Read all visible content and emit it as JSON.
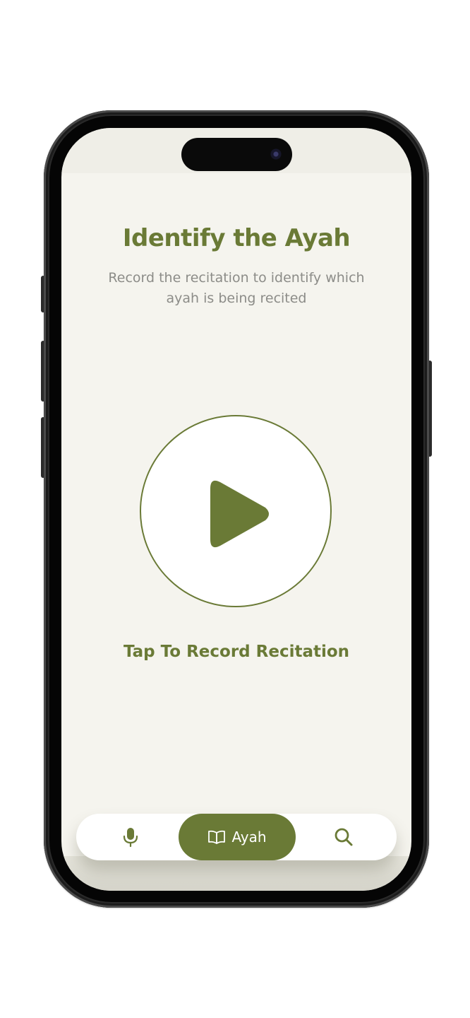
{
  "screen": {
    "title": "Identify the Ayah",
    "subtitle": "Record the recitation to identify which ayah is being recited",
    "record_button_icon": "play-icon",
    "cta_label": "Tap To Record Recitation"
  },
  "bottom_nav": {
    "items": [
      {
        "icon": "microphone-icon",
        "label": "",
        "active": false
      },
      {
        "icon": "book-icon",
        "label": "Ayah",
        "active": true
      },
      {
        "icon": "search-icon",
        "label": "",
        "active": false
      }
    ]
  },
  "colors": {
    "accent": "#6a7a36",
    "background": "#f5f4ee",
    "subtitle_text": "#8c8c88",
    "card": "#ffffff"
  }
}
